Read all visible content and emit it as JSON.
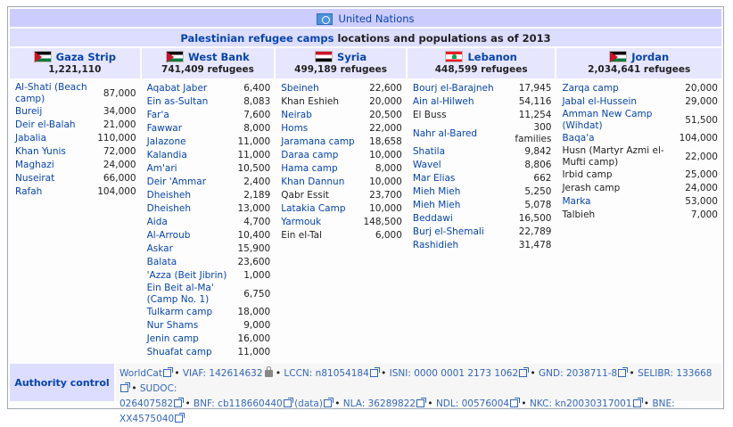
{
  "title": "United Nations",
  "subtitle": {
    "link": "Palestinian refugee camps",
    "rest": " locations and populations as of 2013"
  },
  "regions": [
    {
      "name": "Gaza Strip",
      "flag": "palestine-flag",
      "pop": "1,221,110",
      "camps": [
        {
          "name": "Al-Shati (Beach camp)",
          "value": "87,000",
          "link": true
        },
        {
          "name": "Bureij",
          "value": "34,000",
          "link": true
        },
        {
          "name": "Deir el-Balah",
          "value": "21,000",
          "link": true
        },
        {
          "name": "Jabalia",
          "value": "110,000",
          "link": true
        },
        {
          "name": "Khan Yunis",
          "value": "72,000",
          "link": true
        },
        {
          "name": "Maghazi",
          "value": "24,000",
          "link": true
        },
        {
          "name": "Nuseirat",
          "value": "66,000",
          "link": true
        },
        {
          "name": "Rafah",
          "value": "104,000",
          "link": true
        }
      ]
    },
    {
      "name": "West Bank",
      "flag": "palestine-flag",
      "pop": "741,409 refugees",
      "camps": [
        {
          "name": "Aqabat Jaber",
          "value": "6,400",
          "link": true
        },
        {
          "name": "Ein as-Sultan",
          "value": "8,083",
          "link": true
        },
        {
          "name": "Far'a",
          "value": "7,600",
          "link": true
        },
        {
          "name": "Fawwar",
          "value": "8,000",
          "link": true
        },
        {
          "name": "Jalazone",
          "value": "11,000",
          "link": true
        },
        {
          "name": "Kalandia",
          "value": "11,000",
          "link": true
        },
        {
          "name": "Am'ari",
          "value": "10,500",
          "link": true
        },
        {
          "name": "Deir 'Ammar",
          "value": "2,400",
          "link": true
        },
        {
          "name": "Dheisheh",
          "value": "2,189",
          "link": true
        },
        {
          "name": "Dheisheh",
          "value": "13,000",
          "link": true
        },
        {
          "name": "Aida",
          "value": "4,700",
          "link": true
        },
        {
          "name": "Al-Arroub",
          "value": "10,400",
          "link": true
        },
        {
          "name": "Askar",
          "value": "15,900",
          "link": true
        },
        {
          "name": "Balata",
          "value": "23,600",
          "link": true
        },
        {
          "name": "'Azza (Beit Jibrin)",
          "value": "1,000",
          "link": true
        },
        {
          "name": "Ein Beit al-Ma' (Camp No. 1)",
          "value": "6,750",
          "link": true
        },
        {
          "name": "Tulkarm camp",
          "value": "18,000",
          "link": true
        },
        {
          "name": "Nur Shams",
          "value": "9,000",
          "link": true
        },
        {
          "name": "Jenin camp",
          "value": "16,000",
          "link": true
        },
        {
          "name": "Shuafat camp",
          "value": "11,000",
          "link": true
        }
      ]
    },
    {
      "name": "Syria",
      "flag": "syria-flag",
      "pop": "499,189 refugees",
      "camps": [
        {
          "name": "Sbeineh",
          "value": "22,600",
          "link": true
        },
        {
          "name": "Khan Eshieh",
          "value": "20,000",
          "link": false
        },
        {
          "name": "Neirab",
          "value": "20,500",
          "link": true
        },
        {
          "name": "Homs",
          "value": "22,000",
          "link": true
        },
        {
          "name": "Jaramana camp",
          "value": "18,658",
          "link": true
        },
        {
          "name": "Daraa camp",
          "value": "10,000",
          "link": true
        },
        {
          "name": "Hama camp",
          "value": "8,000",
          "link": true
        },
        {
          "name": "Khan Dannun",
          "value": "10,000",
          "link": true
        },
        {
          "name": "Qabr Essit",
          "value": "23,700",
          "link": false
        },
        {
          "name": "Latakia Camp",
          "value": "10,000",
          "link": true
        },
        {
          "name": "Yarmouk",
          "value": "148,500",
          "link": true
        },
        {
          "name": "Ein el-Tal",
          "value": "6,000",
          "link": false
        }
      ]
    },
    {
      "name": "Lebanon",
      "flag": "lebanon-flag",
      "pop": "448,599 refugees",
      "camps": [
        {
          "name": "Bourj el-Barajneh",
          "value": "17,945",
          "link": true
        },
        {
          "name": "Ain al-Hilweh",
          "value": "54,116",
          "link": true
        },
        {
          "name": "El Buss",
          "value": "11,254",
          "link": false
        },
        {
          "name": "Nahr al-Bared",
          "value": "300 families",
          "link": true
        },
        {
          "name": "Shatila",
          "value": "9,842",
          "link": true
        },
        {
          "name": "Wavel",
          "value": "8,806",
          "link": true
        },
        {
          "name": "Mar Elias",
          "value": "662",
          "link": true
        },
        {
          "name": "Mieh Mieh",
          "value": "5,250",
          "link": true
        },
        {
          "name": "Mieh Mieh",
          "value": "5,078",
          "link": true
        },
        {
          "name": "Beddawi",
          "value": "16,500",
          "link": true
        },
        {
          "name": "Burj el-Shemali",
          "value": "22,789",
          "link": true
        },
        {
          "name": "Rashidieh",
          "value": "31,478",
          "link": true
        }
      ]
    },
    {
      "name": "Jordan",
      "flag": "jordan-flag",
      "pop": "2,034,641 refugees",
      "camps": [
        {
          "name": "Zarqa camp",
          "value": "20,000",
          "link": true
        },
        {
          "name": "Jabal el-Hussein",
          "value": "29,000",
          "link": true
        },
        {
          "name": "Amman New Camp (Wihdat)",
          "value": "51,500",
          "link": true
        },
        {
          "name": "Baqa'a",
          "value": "104,000",
          "link": true
        },
        {
          "name": "Husn (Martyr Azmi el-Mufti camp)",
          "value": "22,000",
          "link": false
        },
        {
          "name": "Irbid camp",
          "value": "25,000",
          "link": false
        },
        {
          "name": "Jerash camp",
          "value": "24,000",
          "link": false
        },
        {
          "name": "Marka",
          "value": "53,000",
          "link": true
        },
        {
          "name": "Talbieh",
          "value": "7,000",
          "link": false
        }
      ]
    }
  ],
  "authority": {
    "label": "Authority control",
    "line1": [
      {
        "text": "WorldCat",
        "ext": true,
        "lock": false
      },
      {
        "text": " • VIAF: 142614632",
        "ext": false,
        "lock": true
      },
      {
        "text": " • LCCN: n81054184",
        "ext": true,
        "lock": false
      },
      {
        "text": " • ISNI: 0000 0001 2173 1062",
        "ext": true,
        "lock": false
      },
      {
        "text": " • GND: 2038711-8",
        "ext": true,
        "lock": false
      },
      {
        "text": " • SELIBR: 133668",
        "ext": true,
        "lock": false
      },
      {
        "text": " • SUDOC:",
        "ext": false,
        "lock": false
      }
    ],
    "line2": [
      {
        "text": "026407582",
        "ext": true,
        "lock": false
      },
      {
        "text": " • BNF: cb118660440",
        "ext": true,
        "lock": false
      },
      {
        "text": " (data)",
        "ext": true,
        "lock": false
      },
      {
        "text": " • NLA: 36289822",
        "ext": true,
        "lock": false
      },
      {
        "text": " • NDL: 00576004",
        "ext": true,
        "lock": false
      },
      {
        "text": " • NKC: kn20030317001",
        "ext": true,
        "lock": false
      },
      {
        "text": " • BNE: XX4575040",
        "ext": true,
        "lock": false
      }
    ]
  }
}
